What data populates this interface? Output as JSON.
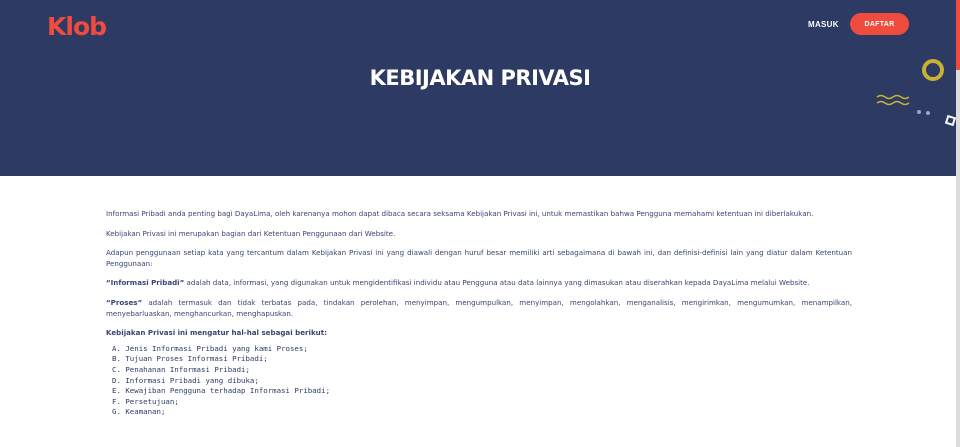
{
  "header": {
    "logo": "Klob",
    "nav": {
      "login_label": "MASUK",
      "register_label": "DAFTAR"
    },
    "title": "KEBIJAKAN PRIVASI"
  },
  "content": {
    "p1": "Informasi Pribadi anda penting bagi DayaLima, oleh karenanya mohon dapat dibaca secara seksama Kebijakan Privasi ini, untuk memastikan bahwa Pengguna memahami ketentuan ini diberlakukan.",
    "p2": "Kebijakan Privasi ini merupakan bagian dari Ketentuan Penggunaan dari Website.",
    "p3": "Adapun penggunaan setiap kata yang tercantum dalam Kebijakan Privasi ini yang diawali dengan huruf besar memiliki arti sebagaimana di bawah ini, dan definisi-definisi lain yang diatur dalam Ketentuan Penggunaan:",
    "def1_term": "“Informasi Pribadi”",
    "def1_text": " adalah data, informasi, yang digunakan untuk mengidentifikasi individu atau Pengguna atau data lainnya yang dimasukan atau diserahkan kepada DayaLima melalui Website.",
    "def2_term": "“Proses”",
    "def2_text": " adalah termasuk dan tidak terbatas pada, tindakan perolehan, menyimpan, mengumpulkan, menyimpan, mengolahkan, menganalisis, mengirimkan, mengumumkan, menampilkan, menyebarluaskan, menghancurkan, menghapuskan.",
    "list_intro": "Kebijakan Privasi ini mengatur hal-hal sebagai berikut:",
    "items": [
      "A. Jenis Informasi Pribadi yang kami Proses;",
      "B. Tujuan Proses Informasi Pribadi;",
      "C. Penahanan Informasi Pribadi;",
      "D. Informasi Pribadi yang dibuka;",
      "E. Kewajiban Pengguna terhadap Informasi Pribadi;",
      "F. Persetujuan;",
      "G. Keamanan;"
    ]
  },
  "colors": {
    "hero_bg": "#2d3a64",
    "brand_red": "#ef4b3f",
    "deco_gold": "#c9b233",
    "body_text": "#3a4470"
  }
}
